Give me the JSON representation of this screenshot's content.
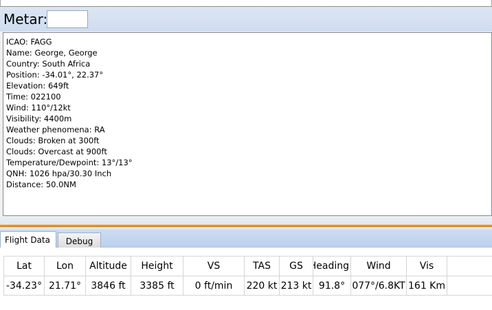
{
  "metar": {
    "label": "Metar:",
    "input_value": ""
  },
  "station_info": {
    "lines": [
      "ICAO: FAGG",
      "Name: George, George",
      "Country: South Africa",
      "Position: -34.01°, 22.37°",
      "Elevation: 649ft",
      "Time: 022100",
      "Wind: 110°/12kt",
      "Visibility: 4400m",
      "Weather phenomena: RA",
      "Clouds: Broken at 300ft",
      "Clouds: Overcast at 900ft",
      "Temperature/Dewpoint: 13°/13°",
      "QNH: 1026 hpa/30.30 Inch",
      "Distance: 50.0NM"
    ]
  },
  "tabs": [
    {
      "label": "Flight Data",
      "active": true
    },
    {
      "label": "Debug",
      "active": false
    }
  ],
  "flight_data": {
    "columns": [
      "Lat",
      "Lon",
      "Altitude",
      "Height",
      "VS",
      "TAS",
      "GS",
      "Heading",
      "Wind",
      "Vis"
    ],
    "rows": [
      [
        "-34.23°",
        "21.71°",
        "3846 ft",
        "3385 ft",
        "0 ft/min",
        "220 kt",
        "213 kt",
        "91.8°",
        "077°/6.8KT",
        "161 Km"
      ]
    ]
  },
  "colors": {
    "accent_splitter": "#e9a23f",
    "tab_strip": "#ccdcf1"
  }
}
